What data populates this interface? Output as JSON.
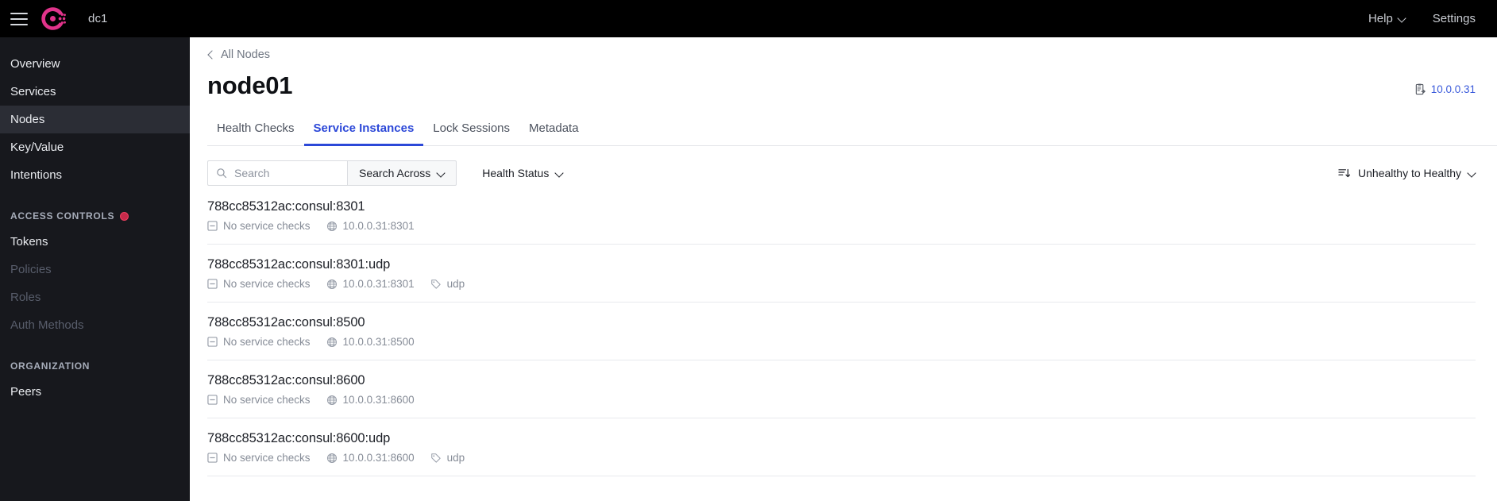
{
  "topbar": {
    "menu_icon": "hamburger-icon",
    "logo_icon": "consul-logo",
    "datacenter": "dc1",
    "help_label": "Help",
    "settings_label": "Settings"
  },
  "sidebar": {
    "items": [
      {
        "label": "Overview",
        "state": "normal"
      },
      {
        "label": "Services",
        "state": "normal"
      },
      {
        "label": "Nodes",
        "state": "active"
      },
      {
        "label": "Key/Value",
        "state": "normal"
      },
      {
        "label": "Intentions",
        "state": "normal"
      }
    ],
    "sections": [
      {
        "title": "ACCESS CONTROLS",
        "has_dot": true,
        "items": [
          {
            "label": "Tokens",
            "state": "normal"
          },
          {
            "label": "Policies",
            "state": "disabled"
          },
          {
            "label": "Roles",
            "state": "disabled"
          },
          {
            "label": "Auth Methods",
            "state": "disabled"
          }
        ]
      },
      {
        "title": "ORGANIZATION",
        "has_dot": false,
        "items": [
          {
            "label": "Peers",
            "state": "normal"
          }
        ]
      }
    ]
  },
  "main": {
    "breadcrumb": "All Nodes",
    "title": "node01",
    "ip_badge": {
      "icon": "copy-clipboard-icon",
      "value": "10.0.0.31"
    },
    "tabs": [
      {
        "label": "Health Checks",
        "active": false
      },
      {
        "label": "Service Instances",
        "active": true
      },
      {
        "label": "Lock Sessions",
        "active": false
      },
      {
        "label": "Metadata",
        "active": false
      }
    ],
    "toolbar": {
      "search_placeholder": "Search",
      "search_value": "",
      "search_across_label": "Search Across",
      "health_status_label": "Health Status",
      "sort_label": "Unhealthy to Healthy",
      "sort_icon": "sort-descending-icon"
    },
    "rows": [
      {
        "title": "788cc85312ac:consul:8301",
        "checks": "No service checks",
        "address": "10.0.0.31:8301",
        "tag": null
      },
      {
        "title": "788cc85312ac:consul:8301:udp",
        "checks": "No service checks",
        "address": "10.0.0.31:8301",
        "tag": "udp"
      },
      {
        "title": "788cc85312ac:consul:8500",
        "checks": "No service checks",
        "address": "10.0.0.31:8500",
        "tag": null
      },
      {
        "title": "788cc85312ac:consul:8600",
        "checks": "No service checks",
        "address": "10.0.0.31:8600",
        "tag": null
      },
      {
        "title": "788cc85312ac:consul:8600:udp",
        "checks": "No service checks",
        "address": "10.0.0.31:8600",
        "tag": "udp"
      }
    ]
  },
  "colors": {
    "brand_pink": "#e0338a",
    "topbar_bg": "#000000",
    "sidebar_bg": "#17181d",
    "sidebar_active_bg": "#2b2d35",
    "accent_blue": "#2c48d8",
    "link_blue": "#3b5bdb",
    "badge_red": "#ef4060"
  }
}
